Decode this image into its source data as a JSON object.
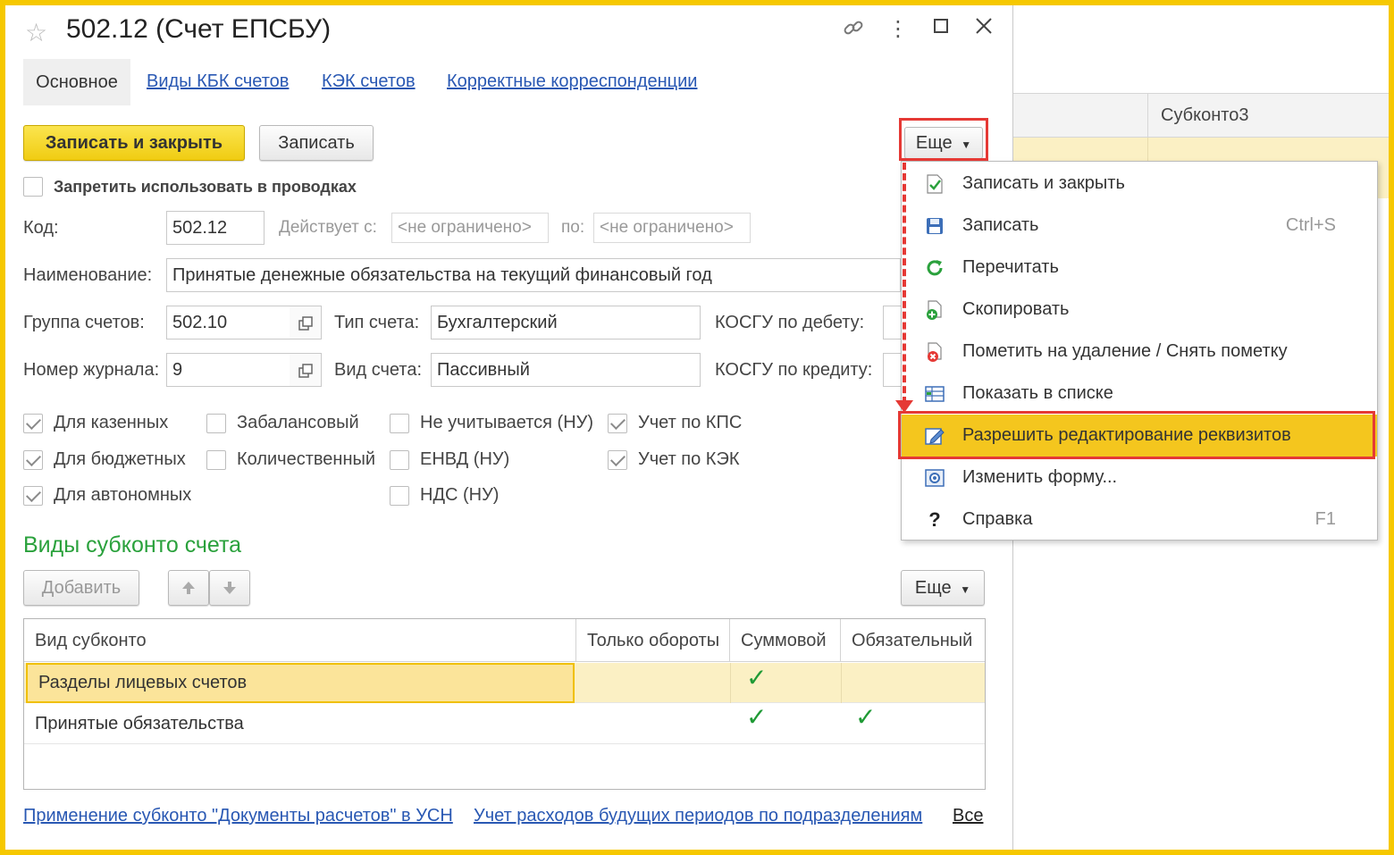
{
  "window": {
    "title": "502.12 (Счет ЕПСБУ)"
  },
  "tabs": {
    "main": "Основное",
    "kbk": "Виды КБК счетов",
    "kek": "КЭК счетов",
    "corr": "Корректные корреспонденции"
  },
  "toolbar": {
    "save_close": "Записать и закрыть",
    "save": "Записать",
    "more": "Еще"
  },
  "form": {
    "forbid_label": "Запретить использовать в проводках",
    "code_label": "Код:",
    "code_value": "502.12",
    "valid_from_label": "Действует с:",
    "valid_from_value": "<не ограничено>",
    "valid_to_label": "по:",
    "valid_to_value": "<не ограничено>",
    "name_label": "Наименование:",
    "name_value": "Принятые денежные обязательства на текущий финансовый год",
    "group_label": "Группа счетов:",
    "group_value": "502.10",
    "type_label": "Тип счета:",
    "type_value": "Бухгалтерский",
    "kosgu_debit_label": "КОСГУ по дебету:",
    "journal_label": "Номер журнала:",
    "journal_value": "9",
    "kind_label": "Вид счета:",
    "kind_value": "Пассивный",
    "kosgu_credit_label": "КОСГУ по кредиту:"
  },
  "checkboxes": [
    {
      "label": "Для казенных",
      "checked": true
    },
    {
      "label": "Для бюджетных",
      "checked": true
    },
    {
      "label": "Для автономных",
      "checked": true
    },
    {
      "label": "Забалансовый",
      "checked": false
    },
    {
      "label": "Количественный",
      "checked": false
    },
    {
      "label": "Не учитывается (НУ)",
      "checked": false
    },
    {
      "label": "ЕНВД (НУ)",
      "checked": false
    },
    {
      "label": "НДС (НУ)",
      "checked": false
    },
    {
      "label": "Учет по КПС",
      "checked": true
    },
    {
      "label": "Учет по КЭК",
      "checked": true
    }
  ],
  "subconto": {
    "title": "Виды субконто счета",
    "add": "Добавить",
    "more": "Еще",
    "columns": [
      "Вид субконто",
      "Только обороты",
      "Суммовой",
      "Обязательный"
    ],
    "rows": [
      {
        "name": "Разделы лицевых счетов",
        "turnover": false,
        "sum": true,
        "required": false
      },
      {
        "name": "Принятые обязательства",
        "turnover": false,
        "sum": true,
        "required": true
      }
    ]
  },
  "footer": {
    "link1": "Применение субконто \"Документы расчетов\" в УСН",
    "link2": "Учет расходов будущих периодов по подразделениям",
    "all": "Все"
  },
  "menu": {
    "items": [
      {
        "label": "Записать и закрыть",
        "shortcut": "",
        "icon": "save-close-icon"
      },
      {
        "label": "Записать",
        "shortcut": "Ctrl+S",
        "icon": "floppy-icon"
      },
      {
        "label": "Перечитать",
        "shortcut": "",
        "icon": "refresh-icon"
      },
      {
        "label": "Скопировать",
        "shortcut": "",
        "icon": "copy-icon"
      },
      {
        "label": "Пометить на удаление / Снять пометку",
        "shortcut": "",
        "icon": "delete-mark-icon"
      },
      {
        "label": "Показать в списке",
        "shortcut": "",
        "icon": "show-list-icon"
      },
      {
        "label": "Разрешить редактирование реквизитов",
        "shortcut": "",
        "icon": "edit-icon"
      },
      {
        "label": "Изменить форму...",
        "shortcut": "",
        "icon": "form-settings-icon"
      },
      {
        "label": "Справка",
        "shortcut": "F1",
        "icon": "help-icon"
      }
    ]
  },
  "background": {
    "column": "Субконто3"
  },
  "colors": {
    "accent_yellow": "#f4c61e",
    "highlight_red": "#e53935",
    "link_blue": "#2958b3",
    "section_green": "#2aa13c",
    "selected_row": "#fbf0c4"
  }
}
